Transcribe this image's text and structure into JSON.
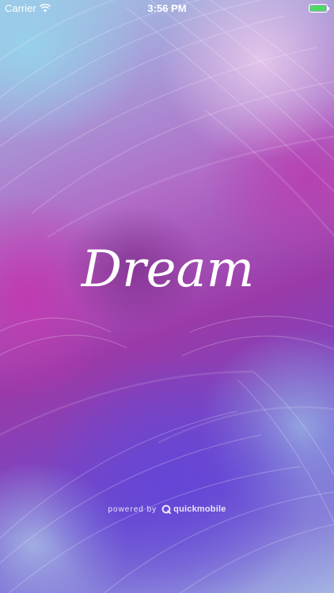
{
  "status_bar": {
    "carrier": "Carrier",
    "time": "3:56 PM",
    "battery_color": "#4cd964",
    "wifi_icon": "wifi-icon",
    "battery_icon": "battery-icon"
  },
  "splash": {
    "logo_text": "Dream",
    "text_color": "#ffffff"
  },
  "footer": {
    "powered_by": "powered by",
    "brand_name": "quickmobile",
    "brand_icon": "quickmobile-logo-icon"
  }
}
